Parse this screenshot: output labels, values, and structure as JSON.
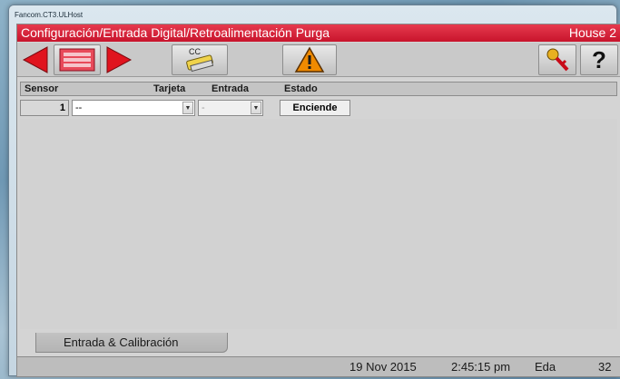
{
  "window": {
    "title": "Fancom.CT3.ULHost"
  },
  "header": {
    "path": "Configuración/Entrada Digital/Retroalimentación Purga",
    "house": "House 2"
  },
  "toolbar": {
    "prev_icon": "arrow-left-icon",
    "list_icon": "list-icon",
    "next_icon": "arrow-right-icon",
    "cc_label": "CC",
    "cc_icon": "cc-equipment-icon",
    "alarm_icon": "warning-icon",
    "keys_icon": "keys-icon",
    "help_label": "?"
  },
  "table": {
    "columns": [
      "Sensor",
      "Tarjeta",
      "Entrada",
      "Estado"
    ],
    "rows": [
      {
        "sensor": "1",
        "tarjeta": "--",
        "entrada": "-",
        "estado": "Enciende"
      }
    ]
  },
  "tabs": [
    {
      "label": "Entrada & Calibración"
    }
  ],
  "status": {
    "date": "19 Nov 2015",
    "time": "2:45:15 pm",
    "code": "Eda",
    "number": "32"
  },
  "colors": {
    "header_red": "#d4203a",
    "accent_red": "#e0141e",
    "warning_orange": "#f08a00"
  }
}
